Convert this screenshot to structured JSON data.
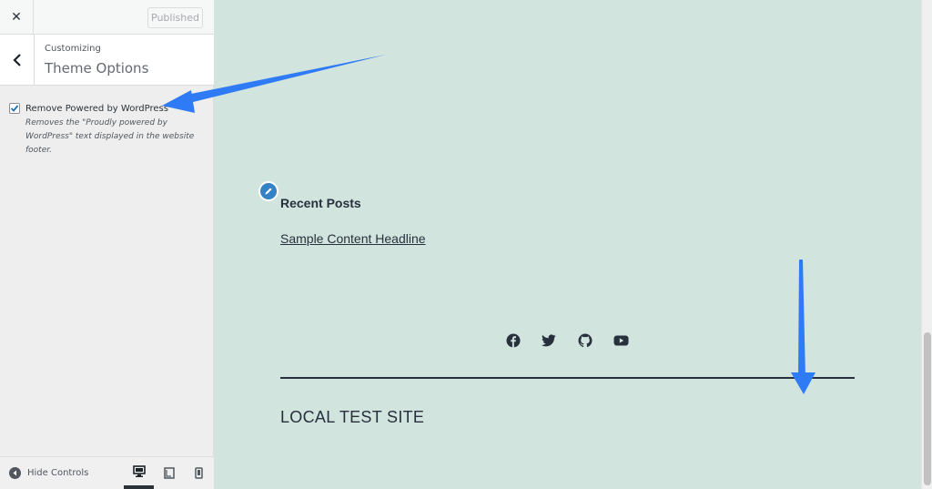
{
  "sidebar": {
    "close_symbol": "✕",
    "publish_label": "Published",
    "customizing_label": "Customizing",
    "section_title": "Theme Options",
    "control": {
      "label": "Remove Powered by WordPress",
      "description": "Removes the \"Proudly powered by WordPress\" text displayed in the website footer.",
      "checked": true
    },
    "hide_controls_label": "Hide Controls",
    "devices": [
      "desktop-icon",
      "tablet-icon",
      "mobile-icon"
    ]
  },
  "preview": {
    "widget_title": "Recent Posts",
    "post_link": "Sample Content Headline",
    "social_icons": [
      "facebook-icon",
      "twitter-icon",
      "github-icon",
      "youtube-icon"
    ],
    "site_title": "LOCAL TEST SITE"
  },
  "colors": {
    "preview_bg": "#d1e4dd",
    "text": "#28303d",
    "annotation_arrow": "#2f7bf5",
    "edit_shortcut": "#3582c4"
  }
}
